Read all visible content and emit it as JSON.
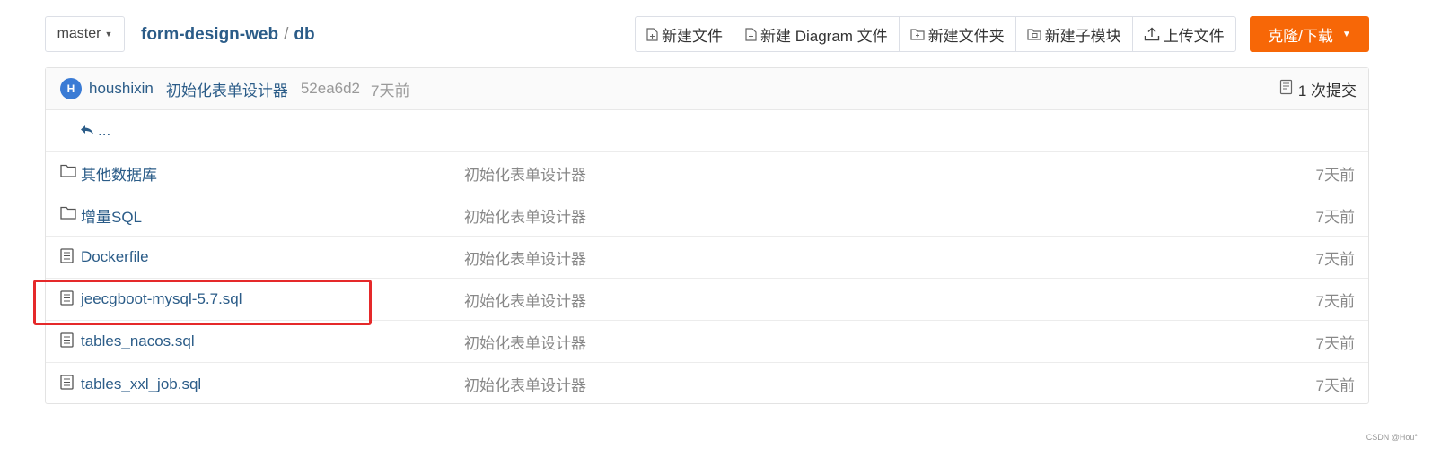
{
  "branch": {
    "label": "master"
  },
  "breadcrumb": {
    "repo": "form-design-web",
    "separator": "/",
    "dir": "db"
  },
  "toolbar": {
    "new_file": "新建文件",
    "new_diagram": "新建 Diagram 文件",
    "new_folder": "新建文件夹",
    "new_submodule": "新建子模块",
    "upload": "上传文件",
    "clone": "克隆/下载"
  },
  "commit": {
    "avatar_letter": "H",
    "author": "houshixin",
    "message": "初始化表单设计器",
    "hash": "52ea6d2",
    "time": "7天前",
    "count": "1 次提交"
  },
  "parent_link": "...",
  "files": [
    {
      "type": "folder",
      "name": "其他数据库",
      "commit": "初始化表单设计器",
      "time": "7天前"
    },
    {
      "type": "folder",
      "name": "增量SQL",
      "commit": "初始化表单设计器",
      "time": "7天前"
    },
    {
      "type": "file",
      "name": "Dockerfile",
      "commit": "初始化表单设计器",
      "time": "7天前"
    },
    {
      "type": "file",
      "name": "jeecgboot-mysql-5.7.sql",
      "commit": "初始化表单设计器",
      "time": "7天前"
    },
    {
      "type": "file",
      "name": "tables_nacos.sql",
      "commit": "初始化表单设计器",
      "time": "7天前"
    },
    {
      "type": "file",
      "name": "tables_xxl_job.sql",
      "commit": "初始化表单设计器",
      "time": "7天前"
    }
  ],
  "watermark": "CSDN @Hou°",
  "colors": {
    "accent": "#f76707",
    "link": "#2b5c88",
    "highlight": "#e5292a",
    "avatar": "#3a7bd5"
  }
}
